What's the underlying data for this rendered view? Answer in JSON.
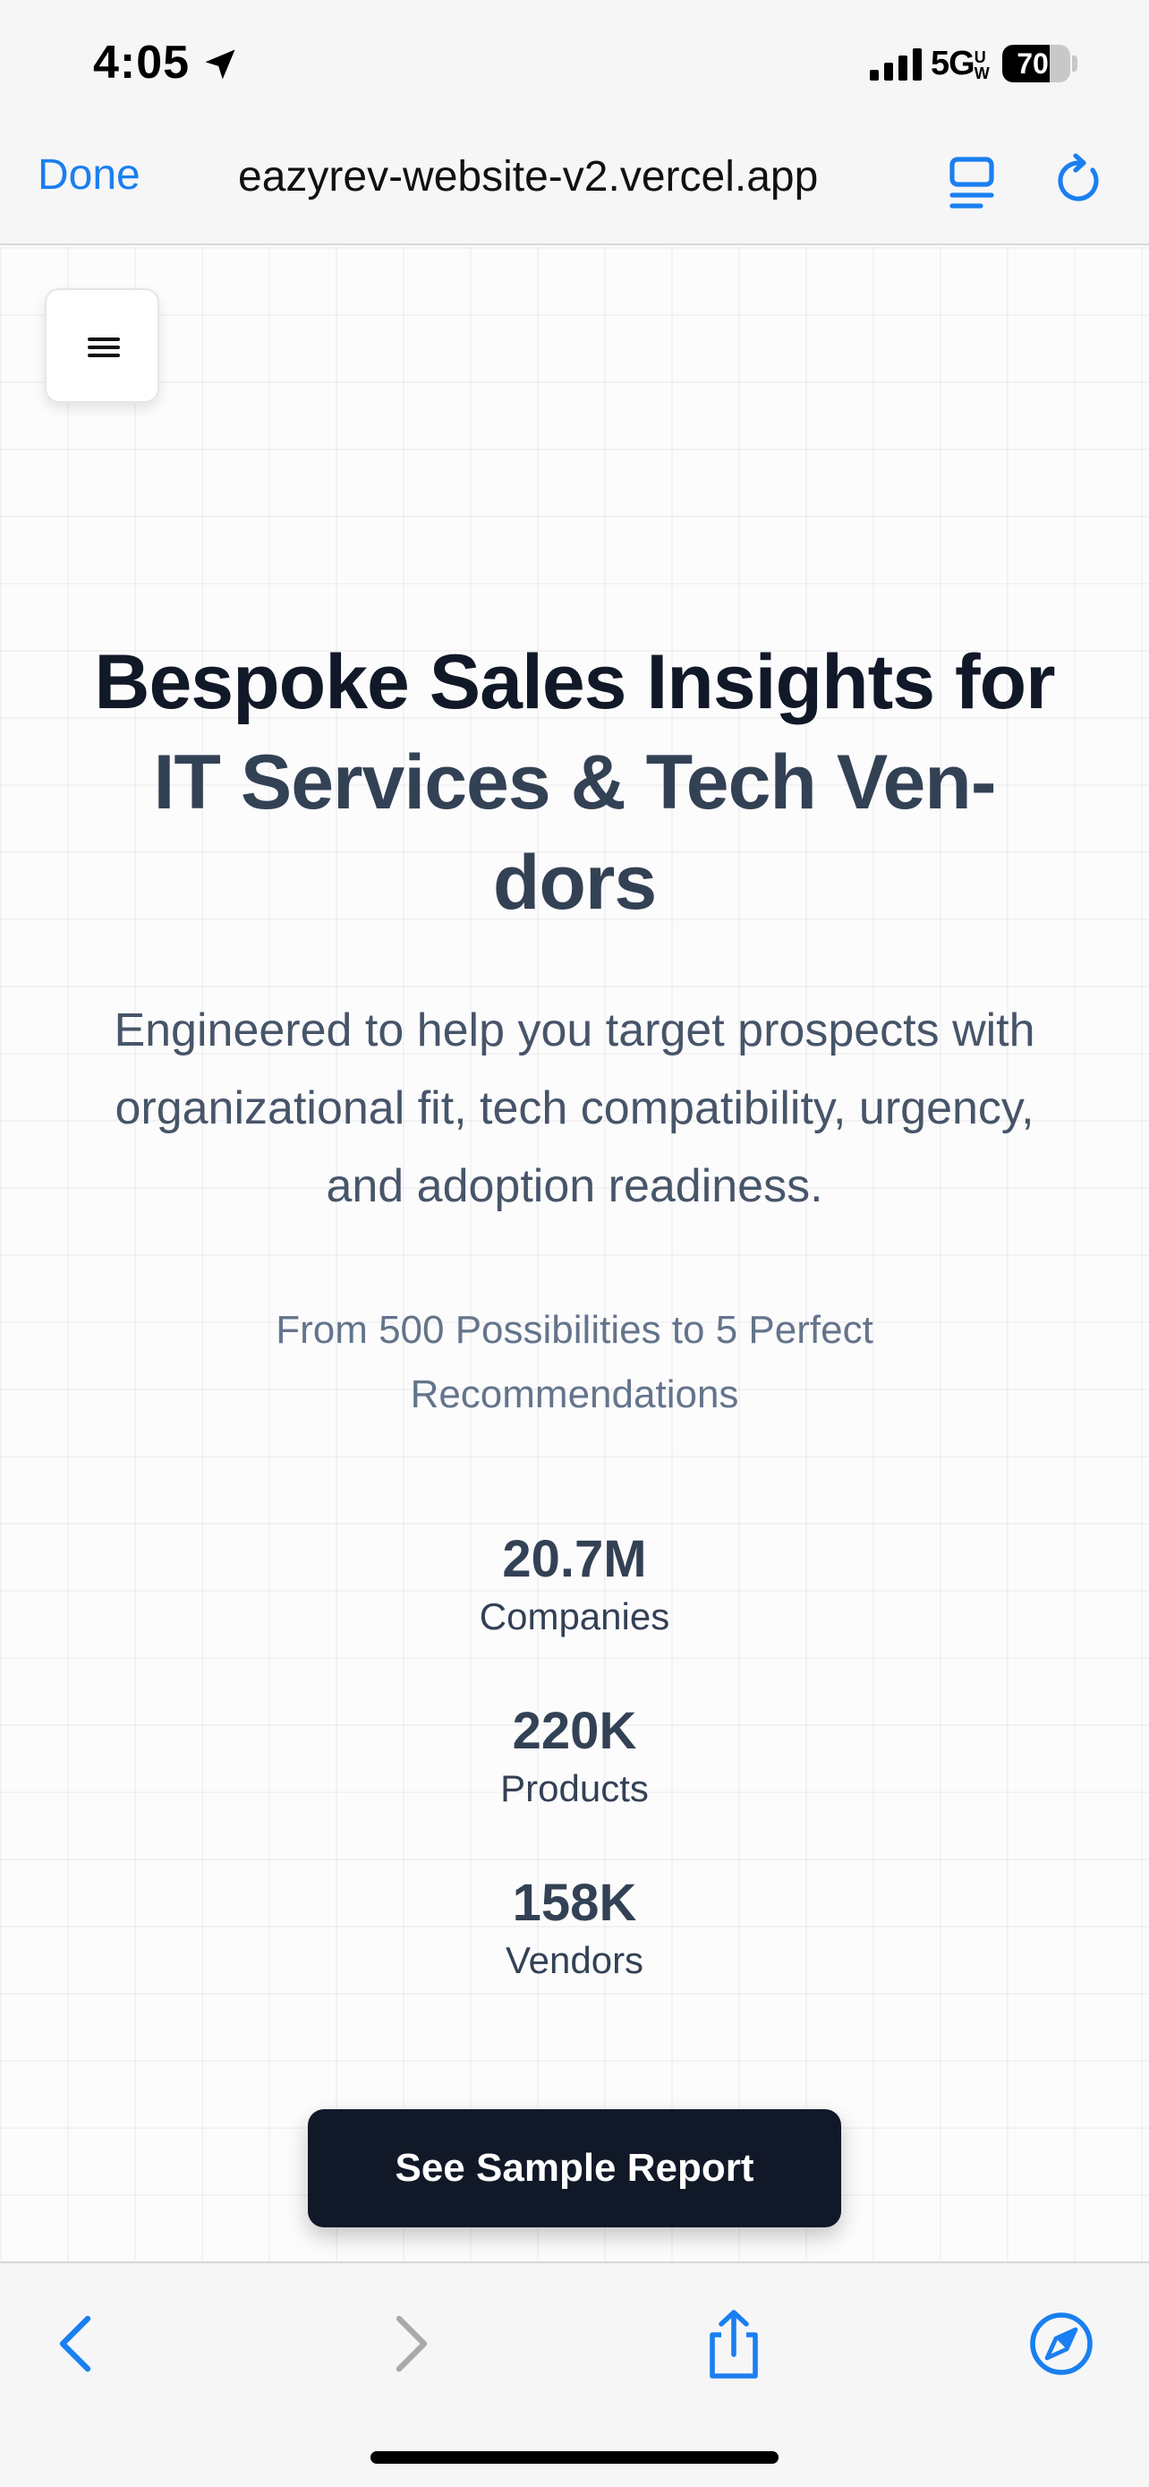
{
  "status_bar": {
    "time": "4:05",
    "network": "5G",
    "network_suffix": "UW",
    "battery": "70",
    "battery_level": 0.7
  },
  "browser": {
    "done_label": "Done",
    "url": "eazyrev-website-v2.vercel.app"
  },
  "hero": {
    "title_line1": "Bespoke Sales Insights for",
    "title_line2": "IT Services & Tech Ven-",
    "title_line3": "dors",
    "subtitle": "Engineered to help you target prospects with organizational fit, tech compatibility, urgency, and adoption readiness.",
    "tagline": "From 500 Possibilities to 5 Perfect Recommendations"
  },
  "stats": [
    {
      "value": "20.7M",
      "label": "Companies"
    },
    {
      "value": "220K",
      "label": "Products"
    },
    {
      "value": "158K",
      "label": "Vendors"
    }
  ],
  "cta": {
    "label": "See Sample Report"
  },
  "colors": {
    "accent": "#1a7ff0",
    "title_dark": "#111827",
    "title_slate": "#334155",
    "cta_bg": "#111827"
  },
  "icons": {
    "menu": "hamburger-icon",
    "reader": "reader-mode-icon",
    "reload": "reload-icon",
    "back": "chevron-left-icon",
    "forward": "chevron-right-icon",
    "share": "share-icon",
    "safari": "compass-icon"
  }
}
